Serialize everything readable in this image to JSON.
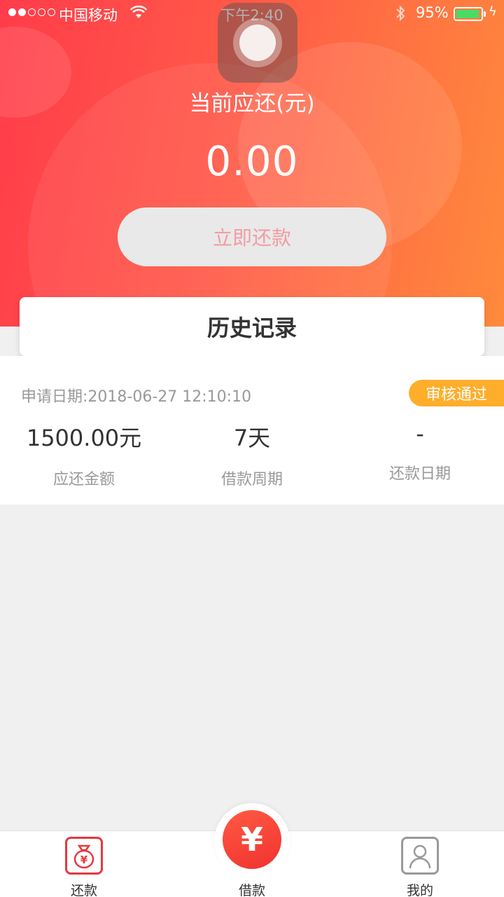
{
  "status_bar": {
    "carrier": "中国移动",
    "time": "下午2:40",
    "battery": "95%",
    "battery_level": 0.95
  },
  "hero": {
    "due_label": "当前应还(元)",
    "due_amount": "0.00",
    "pay_button": "立即还款"
  },
  "history": {
    "title": "历史记录"
  },
  "record": {
    "date": "申请日期:2018-06-27 12:10:10",
    "status": "审核通过",
    "columns": [
      {
        "value": "1500.00元",
        "label": "应还金额"
      },
      {
        "value": "7天",
        "label": "借款周期"
      },
      {
        "value": "-",
        "label": "还款日期"
      }
    ]
  },
  "tabs": [
    {
      "label": "还款",
      "icon": "money-bag-icon"
    },
    {
      "label": "借款",
      "icon": "yen-icon",
      "glyph": "¥"
    },
    {
      "label": "我的",
      "icon": "user-icon"
    }
  ],
  "colors": {
    "brand": "#ff3c4b",
    "accent_orange": "#ff8a3c",
    "status_badge": "#ffae2b"
  }
}
